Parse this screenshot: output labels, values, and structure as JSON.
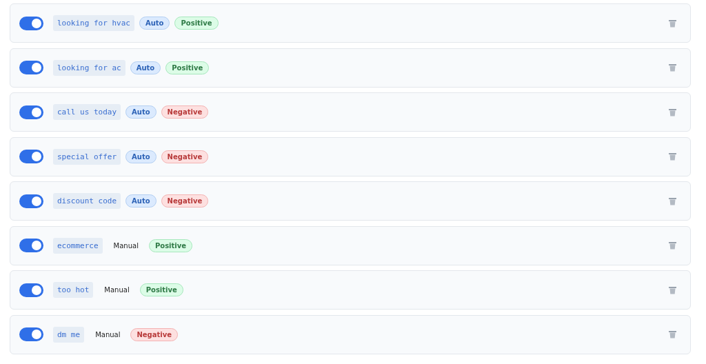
{
  "rules": [
    {
      "on": true,
      "phrase": "looking for hvac",
      "mode": {
        "kind": "tag",
        "label": "Auto"
      },
      "sentiment": {
        "kind": "positive",
        "label": "Positive"
      }
    },
    {
      "on": true,
      "phrase": "looking for ac",
      "mode": {
        "kind": "tag",
        "label": "Auto"
      },
      "sentiment": {
        "kind": "positive",
        "label": "Positive"
      }
    },
    {
      "on": true,
      "phrase": "call us today",
      "mode": {
        "kind": "tag",
        "label": "Auto"
      },
      "sentiment": {
        "kind": "negative",
        "label": "Negative"
      }
    },
    {
      "on": true,
      "phrase": "special offer",
      "mode": {
        "kind": "tag",
        "label": "Auto"
      },
      "sentiment": {
        "kind": "negative",
        "label": "Negative"
      }
    },
    {
      "on": true,
      "phrase": "discount code",
      "mode": {
        "kind": "tag",
        "label": "Auto"
      },
      "sentiment": {
        "kind": "negative",
        "label": "Negative"
      }
    },
    {
      "on": true,
      "phrase": "ecommerce",
      "mode": {
        "kind": "plain",
        "label": "Manual"
      },
      "sentiment": {
        "kind": "positive",
        "label": "Positive"
      }
    },
    {
      "on": true,
      "phrase": "too hot",
      "mode": {
        "kind": "plain",
        "label": "Manual"
      },
      "sentiment": {
        "kind": "positive",
        "label": "Positive"
      }
    },
    {
      "on": true,
      "phrase": "dm me",
      "mode": {
        "kind": "plain",
        "label": "Manual"
      },
      "sentiment": {
        "kind": "negative",
        "label": "Negative"
      }
    }
  ]
}
